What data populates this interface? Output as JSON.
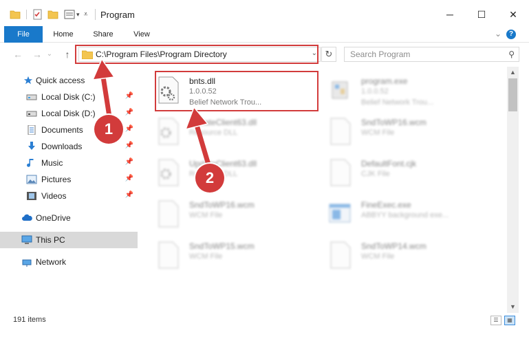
{
  "window": {
    "title": "Program",
    "minimize": "─",
    "maximize": "☐",
    "close": "✕"
  },
  "ribbon": {
    "tabs": [
      "File",
      "Home",
      "Share",
      "View"
    ],
    "collapse": "⌄",
    "help": "?"
  },
  "address": {
    "path": "C:\\Program Files\\Program Directory",
    "dropdown": "⌄",
    "refresh": "↻"
  },
  "nav": {
    "back": "←",
    "forward": "→",
    "history": "⌄",
    "up": "↑"
  },
  "search": {
    "placeholder": "Search Program",
    "icon": "⚲"
  },
  "sidebar": {
    "items": [
      {
        "label": "Quick access",
        "icon": "star-icon",
        "pinned": false
      },
      {
        "label": "Local Disk (C:)",
        "icon": "drive-icon",
        "pinned": true
      },
      {
        "label": "Local Disk (D:)",
        "icon": "drive-icon",
        "pinned": true
      },
      {
        "label": "Documents",
        "icon": "documents-icon",
        "pinned": true
      },
      {
        "label": "Downloads",
        "icon": "download-icon",
        "pinned": true
      },
      {
        "label": "Music",
        "icon": "music-icon",
        "pinned": true
      },
      {
        "label": "Pictures",
        "icon": "pictures-icon",
        "pinned": true
      },
      {
        "label": "Videos",
        "icon": "videos-icon",
        "pinned": true
      },
      {
        "label": "OneDrive",
        "icon": "cloud-icon",
        "pinned": false
      },
      {
        "label": "This PC",
        "icon": "computer-icon",
        "pinned": false,
        "selected": true
      },
      {
        "label": "Network",
        "icon": "network-icon",
        "pinned": false
      }
    ],
    "pin_glyph": "📌"
  },
  "files": [
    {
      "name": "bnts.dll",
      "line1": "1.0.0.52",
      "line2": "Belief Network Trou...",
      "icon": "dll-gear-icon",
      "highlighted": true
    },
    {
      "name": "program.exe",
      "line1": "1.0.0.52",
      "line2": "Belief Network Trou...",
      "icon": "exe-icon",
      "highlighted": false
    },
    {
      "name": "UpdateClient63.dll",
      "line1": "Resource DLL",
      "line2": "",
      "icon": "dll-gear-icon",
      "highlighted": false
    },
    {
      "name": "SndToWP16.wcm",
      "line1": "WCM File",
      "line2": "",
      "icon": "blank-file-icon",
      "highlighted": false
    },
    {
      "name": "UpdateClient63.dll",
      "line1": "Resource DLL",
      "line2": "",
      "icon": "dll-gear-icon",
      "highlighted": false
    },
    {
      "name": "DefaultFont.cjk",
      "line1": "CJK File",
      "line2": "",
      "icon": "blank-file-icon",
      "highlighted": false
    },
    {
      "name": "SndToWP16.wcm",
      "line1": "WCM File",
      "line2": "",
      "icon": "blank-file-icon",
      "highlighted": false
    },
    {
      "name": "FineExec.exe",
      "line1": "ABBYY background exe...",
      "line2": "",
      "icon": "app-window-icon",
      "highlighted": false
    },
    {
      "name": "SndToWP15.wcm",
      "line1": "WCM File",
      "line2": "",
      "icon": "blank-file-icon",
      "highlighted": false
    },
    {
      "name": "SndToWP14.wcm",
      "line1": "WCM File",
      "line2": "",
      "icon": "blank-file-icon",
      "highlighted": false
    }
  ],
  "status": {
    "count": "191 items"
  },
  "scroll": {
    "up": "▲",
    "down": "▼"
  },
  "callouts": {
    "one": "1",
    "two": "2"
  },
  "colors": {
    "accent": "#1979ca",
    "highlight": "#d23b3b",
    "selection": "#d9d9d9",
    "folder": "#f3c550"
  }
}
